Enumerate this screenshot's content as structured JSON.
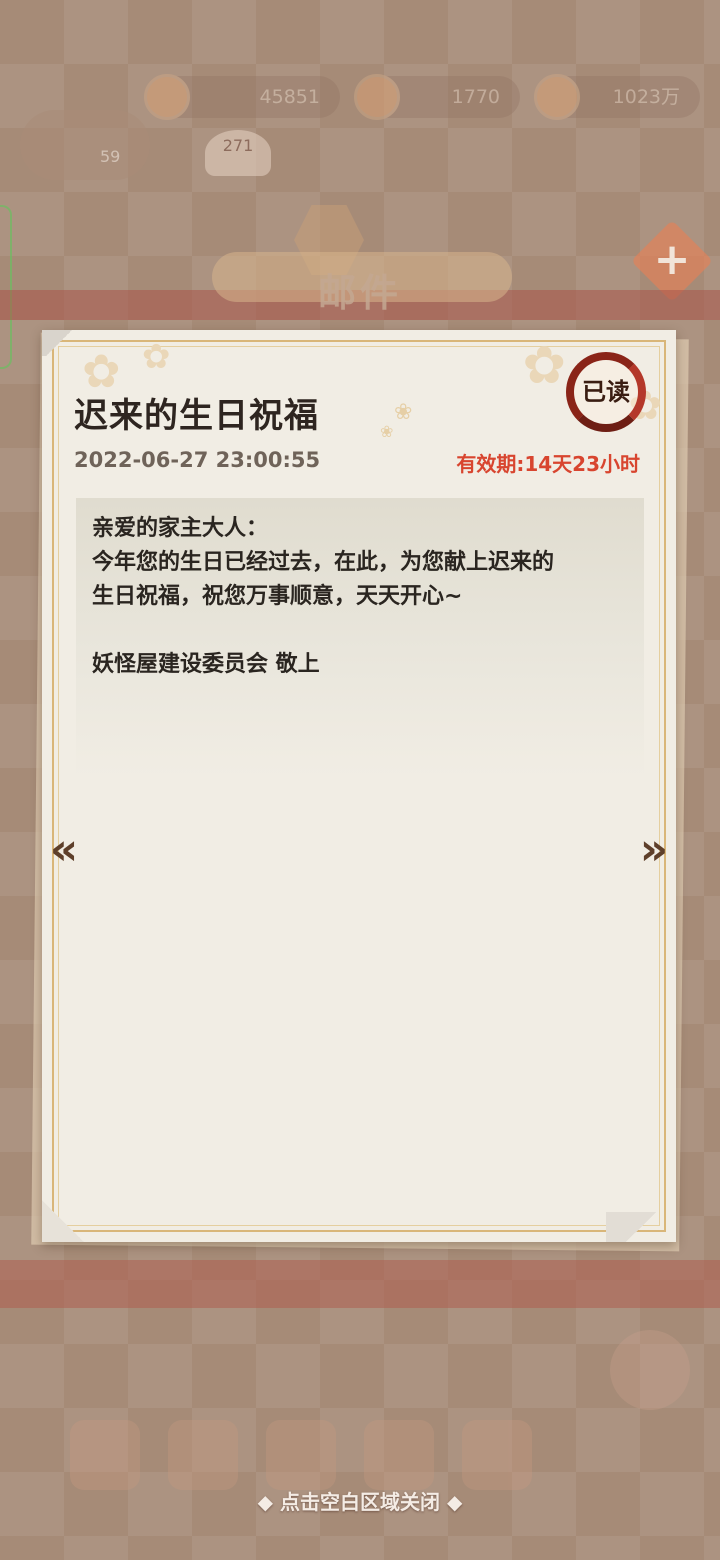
{
  "header": {
    "title": "邮件",
    "resources": [
      "45851",
      "1770",
      "1023万"
    ],
    "level": "59",
    "fan_label": "271"
  },
  "mail": {
    "title": "迟来的生日祝福",
    "date": "2022-06-27 23:00:55",
    "expiry": "有效期:14天23小时",
    "status_stamp": "已读",
    "body": {
      "greeting": "亲爱的家主大人：",
      "line1": "今年您的生日已经过去，在此，为您献上迟来的",
      "line2": "生日祝福，祝您万事顺意，天天开心~",
      "signature": "妖怪屋建设委员会 敬上"
    }
  },
  "nav": {
    "prev_icon": "chevron-left-icon",
    "next_icon": "chevron-right-icon"
  },
  "footer": {
    "close_hint": "◆ 点击空白区域关闭 ◆"
  },
  "colors": {
    "expiry": "#d8452f",
    "stamp": "#8a2418",
    "paper": "#f1ede4"
  }
}
